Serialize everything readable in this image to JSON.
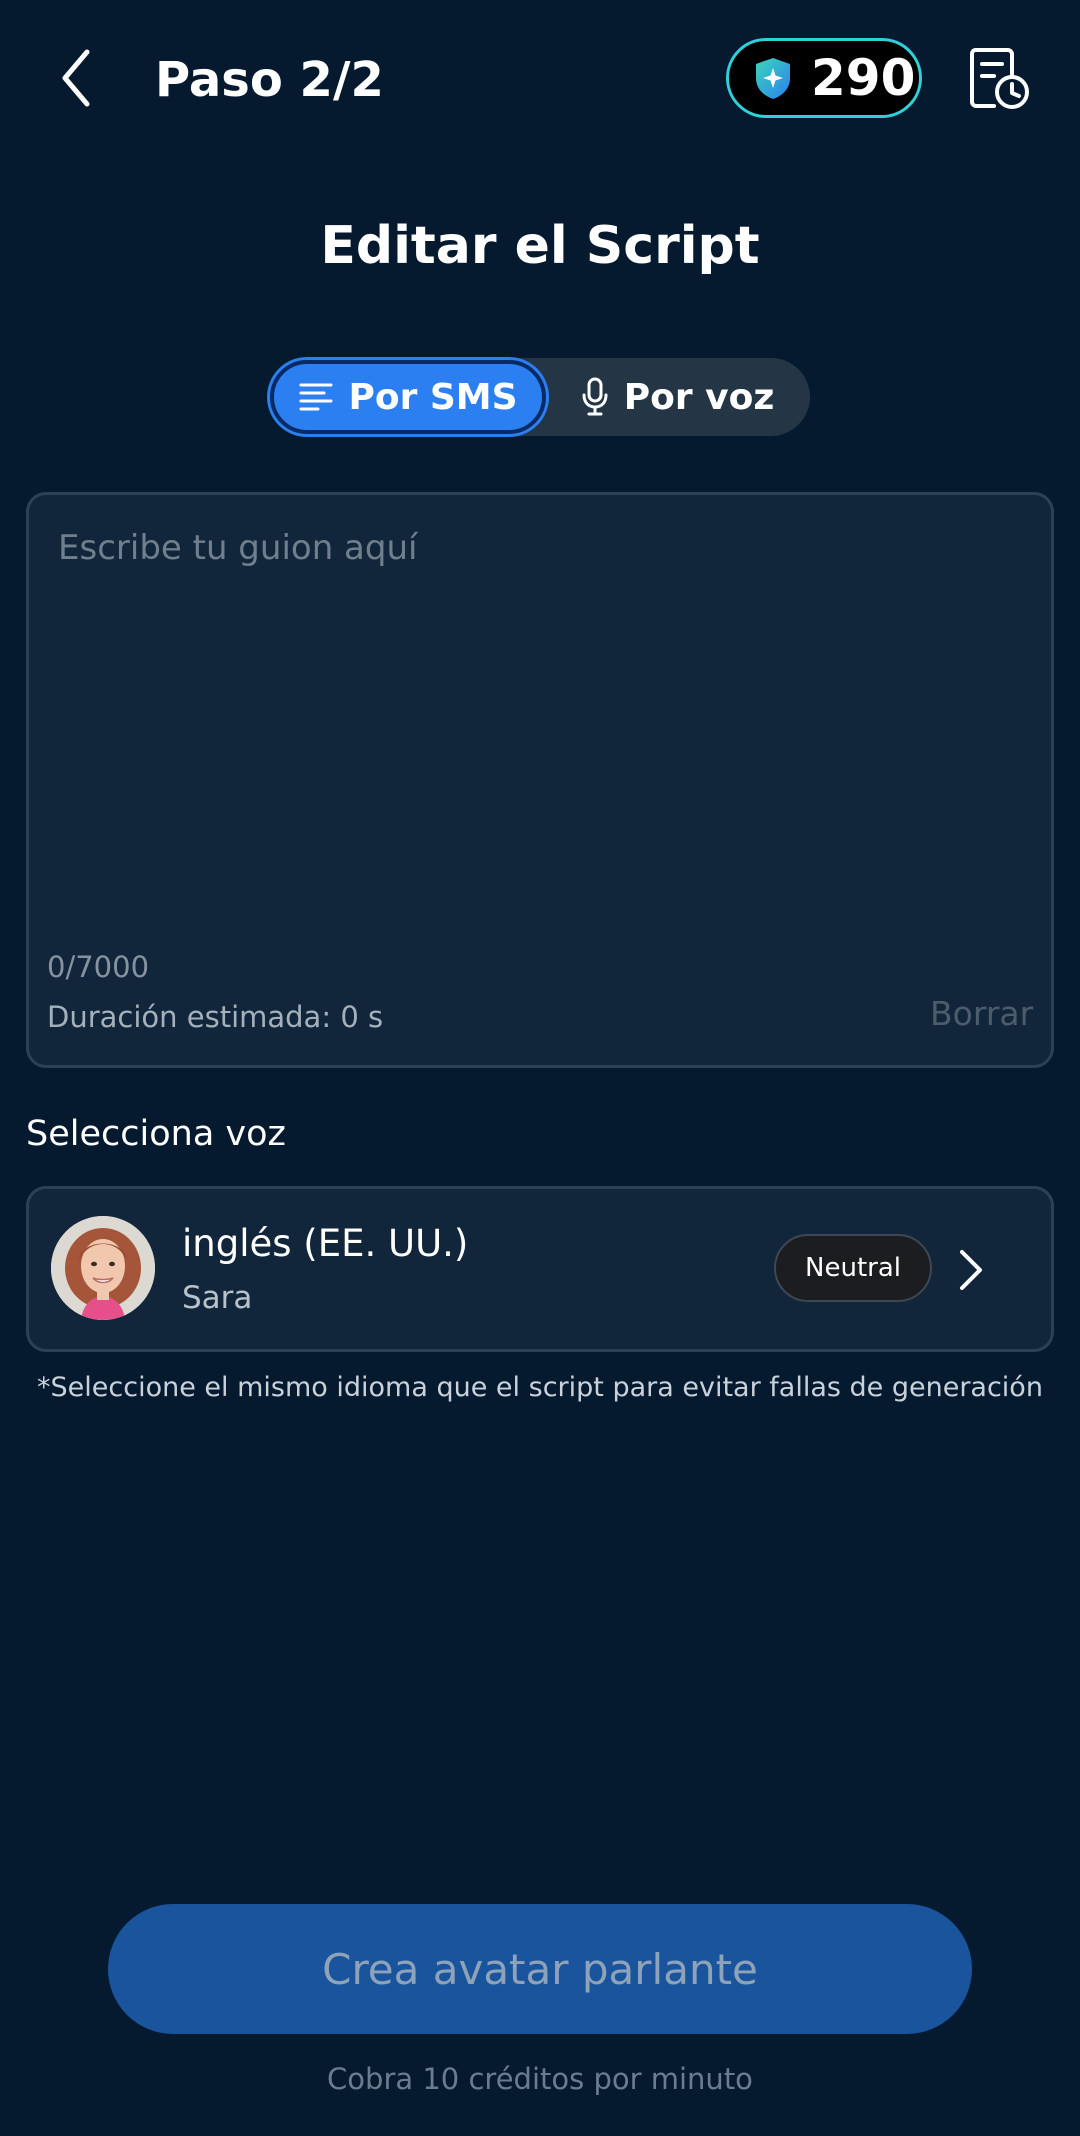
{
  "header": {
    "step": "Paso 2/2",
    "credits": "290"
  },
  "title": "Editar el Script",
  "tabs": {
    "sms": "Por SMS",
    "voice": "Por voz"
  },
  "script": {
    "placeholder": "Escribe tu guion aquí",
    "value": "",
    "char_count": "0/7000",
    "duration": "Duración estimada: 0 s",
    "clear_label": "Borrar"
  },
  "voice": {
    "section_label": "Selecciona voz",
    "language": "inglés (EE. UU.)",
    "name": "Sara",
    "tone": "Neutral",
    "note": "*Seleccione el mismo idioma que el script para evitar fallas de generación"
  },
  "cta": {
    "label": "Crea avatar parlante",
    "note": "Cobra 10 créditos por minuto"
  },
  "colors": {
    "background": "#051a2f",
    "accent": "#2b7ff0",
    "cta": "#19549d",
    "credits_border": "#2fd0d8"
  },
  "icons": {
    "back": "chevron-left-icon",
    "credits": "shield-star-icon",
    "history": "document-clock-icon",
    "sms": "text-lines-icon",
    "voice": "microphone-icon",
    "select": "chevron-right-icon"
  }
}
